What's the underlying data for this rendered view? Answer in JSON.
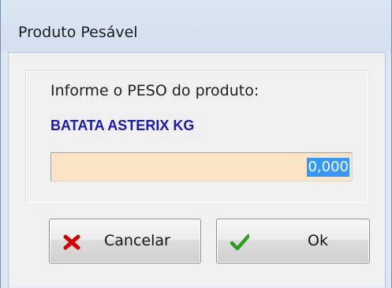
{
  "window": {
    "title": "Produto Pesável"
  },
  "dialog": {
    "prompt": "Informe o PESO do produto:",
    "product_name": "BATATA ASTERIX KG",
    "weight_value": "0,000"
  },
  "buttons": {
    "cancel_label": "Cancelar",
    "cancel_icon": "red-x-icon",
    "ok_label": "Ok",
    "ok_icon": "green-check-icon"
  },
  "colors": {
    "product_name": "#1a1ab8",
    "input_background": "#fbe4c6",
    "selection": "#3399ff",
    "cancel_icon": "#d40000",
    "ok_icon": "#2e9e1e"
  }
}
